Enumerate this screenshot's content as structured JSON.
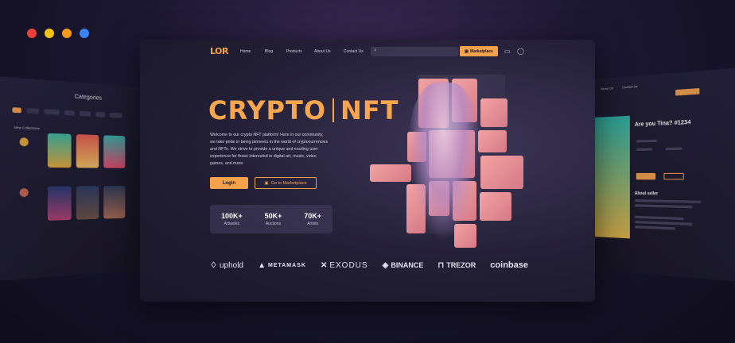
{
  "window_dots": [
    "#e8413a",
    "#f2c21b",
    "#f29a1b",
    "#3a82f0"
  ],
  "left_panel": {
    "title": "Categories",
    "section": "New Collections"
  },
  "right_panel": {
    "title": "Are you Tina? #1234",
    "about": "About seller",
    "nav": [
      "About Us",
      "Contact Us"
    ]
  },
  "nav": {
    "logo": "LOR",
    "links": [
      "Home",
      "Blog",
      "Products",
      "About Us",
      "Contact Us"
    ],
    "marketplace_label": "Marketplace",
    "icons": [
      "search-icon",
      "wallet-icon",
      "user-icon"
    ]
  },
  "hero": {
    "title_left": "CRYPTO",
    "title_right": "NFT",
    "description": "Welcome to our crypto NFT platform! Here in our community, we take pride in being pioneers in the world of cryptocurrencies and NFTs. We strive to provide a unique and exciting user experience for those interested in digital art, music, video games, and more.",
    "login_label": "Login",
    "goto_label": "Go to Marketplace"
  },
  "stats": [
    {
      "value": "100K+",
      "label": "Artworks"
    },
    {
      "value": "50K+",
      "label": "Auctions"
    },
    {
      "value": "70K+",
      "label": "Artists"
    }
  ],
  "partners": [
    "uphold",
    "METAMASK",
    "EXODUS",
    "BINANCE",
    "TREZOR",
    "coinbase"
  ],
  "colors": {
    "accent": "#f3a14a",
    "bg": "#1a1729"
  }
}
